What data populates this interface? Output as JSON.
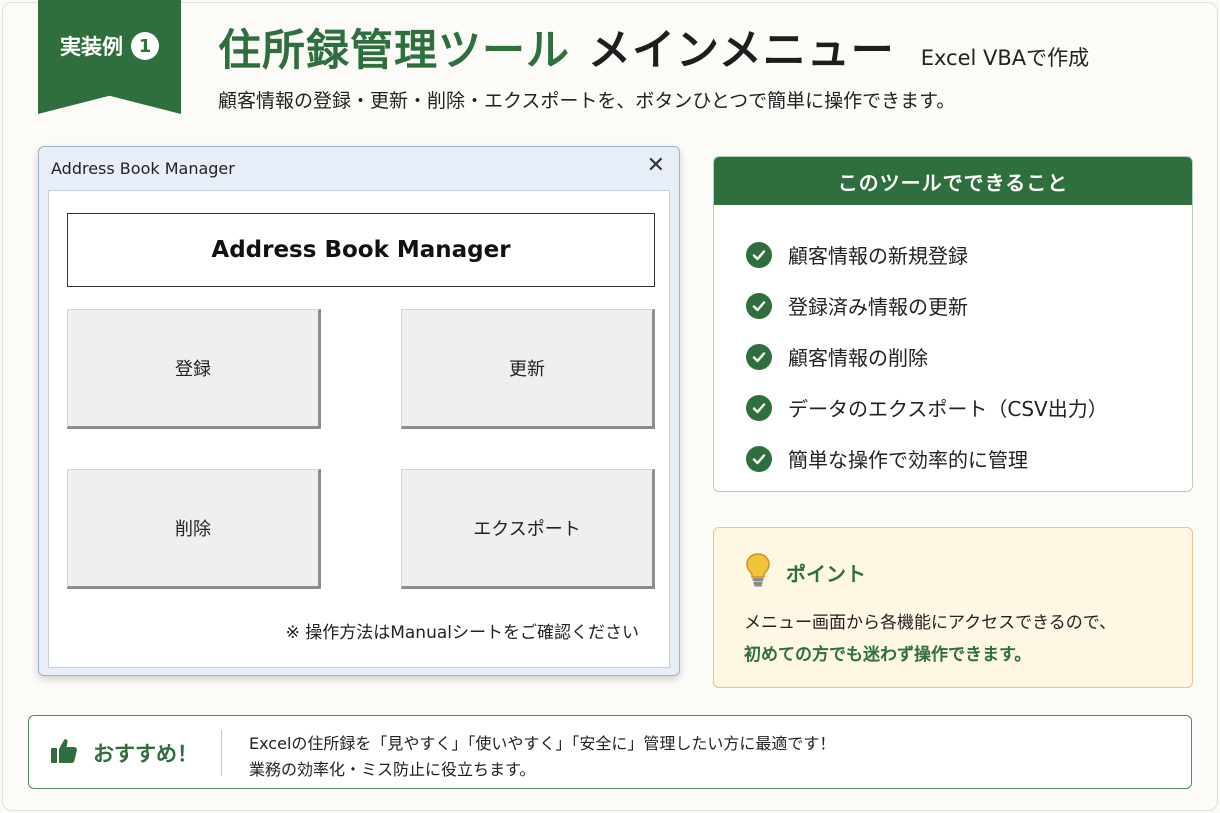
{
  "badge": {
    "label": "実装例",
    "number": "1"
  },
  "header": {
    "title_green": "住所録管理ツール",
    "title_black": "メインメニュー",
    "title_small": "Excel VBAで作成",
    "subtitle": "顧客情報の登録・更新・削除・エクスポートを、ボタンひとつで簡単に操作できます。"
  },
  "window": {
    "title": "Address Book Manager",
    "close_glyph": "✕",
    "form_header": "Address Book Manager",
    "buttons": {
      "register": "登録",
      "update": "更新",
      "delete": "削除",
      "export": "エクスポート"
    },
    "note": "※ 操作方法はManualシートをご確認ください"
  },
  "features": {
    "heading": "このツールでできること",
    "items": [
      "顧客情報の新規登録",
      "登録済み情報の更新",
      "顧客情報の削除",
      "データのエクスポート（CSV出力）",
      "簡単な操作で効率的に管理"
    ],
    "check_icon": "check-circle-icon"
  },
  "point": {
    "icon": "lightbulb-icon",
    "title": "ポイント",
    "line1": "メニュー画面から各機能にアクセスできるので、",
    "line2": "初めての方でも迷わず操作できます。"
  },
  "recommend": {
    "icon": "thumbs-up-icon",
    "label": "おすすめ！",
    "line1": "Excelの住所録を「見やすく」「使いやすく」「安全に」管理したい方に最適です！",
    "line2": "業務の効率化・ミス防止に役立ちます。"
  },
  "colors": {
    "brand_green": "#2f6e3d",
    "point_bg": "#fdf7e3",
    "window_bg": "#e8eef8"
  }
}
